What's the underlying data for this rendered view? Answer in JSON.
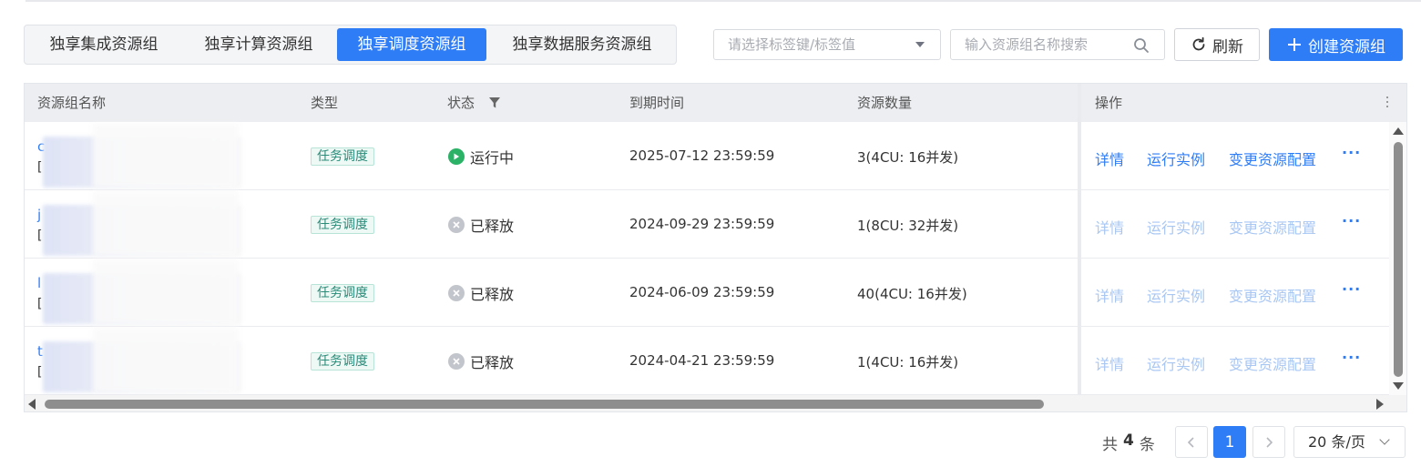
{
  "tabs": [
    {
      "label": "独享集成资源组",
      "active": false
    },
    {
      "label": "独享计算资源组",
      "active": false
    },
    {
      "label": "独享调度资源组",
      "active": true
    },
    {
      "label": "独享数据服务资源组",
      "active": false
    }
  ],
  "toolbar": {
    "tag_select_placeholder": "请选择标签键/标签值",
    "search_placeholder": "输入资源组名称搜索",
    "search_value": "",
    "refresh_label": "刷新",
    "create_label": "创建资源组"
  },
  "table": {
    "headers": {
      "name": "资源组名称",
      "type": "类型",
      "status": "状态",
      "expire": "到期时间",
      "quantity": "资源数量",
      "actions": "操作"
    },
    "rows": [
      {
        "name_initial": "c",
        "desc_initial": "[",
        "type": "任务调度",
        "status": "运行中",
        "status_kind": "running",
        "expire": "2025-07-12 23:59:59",
        "quantity": "3(4CU: 16并发)",
        "enabled": true
      },
      {
        "name_initial": "j",
        "desc_initial": "[",
        "type": "任务调度",
        "status": "已释放",
        "status_kind": "released",
        "expire": "2024-09-29 23:59:59",
        "quantity": "1(8CU: 32并发)",
        "enabled": false
      },
      {
        "name_initial": "l",
        "desc_initial": "[",
        "type": "任务调度",
        "status": "已释放",
        "status_kind": "released",
        "expire": "2024-06-09 23:59:59",
        "quantity": "40(4CU: 16并发)",
        "enabled": false
      },
      {
        "name_initial": "t",
        "desc_initial": "[",
        "type": "任务调度",
        "status": "已释放",
        "status_kind": "released",
        "expire": "2024-04-21 23:59:59",
        "quantity": "1(4CU: 16并发)",
        "enabled": false
      }
    ],
    "actions": {
      "detail": "详情",
      "instances": "运行实例",
      "change_config": "变更资源配置",
      "more": "···"
    }
  },
  "pagination": {
    "total_prefix": "共",
    "total_count": "4",
    "total_suffix": "条",
    "current_page": "1",
    "page_size": "20 条/页"
  },
  "colors": {
    "primary": "#2f7df6",
    "running": "#2cb267",
    "released": "#c2c5cb",
    "badge_text": "#2a8b78"
  }
}
